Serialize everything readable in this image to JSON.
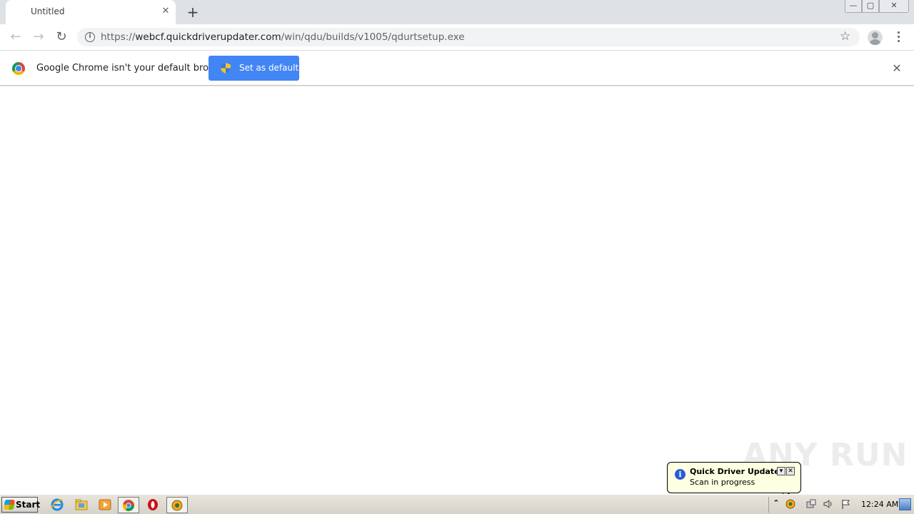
{
  "browser": {
    "tab": {
      "title": "Untitled",
      "close_glyph": "✕"
    },
    "new_tab_glyph": "+",
    "window_controls": {
      "minimize": "—",
      "maximize": "▢",
      "close": "✕"
    },
    "nav": {
      "back": "←",
      "forward": "→",
      "reload": "↻"
    },
    "omnibox": {
      "scheme": "https://",
      "host": "webcf.quickdriverupdater.com",
      "path": "/win/qdu/builds/v1005/qdurtsetup.exe"
    },
    "bookmark_star": "☆"
  },
  "infobar": {
    "message": "Google Chrome isn't your default browser",
    "button_label": "Set as default",
    "close_glyph": "✕"
  },
  "watermark": "ANY RUN",
  "balloon": {
    "title": "Quick Driver Updater",
    "text": "Scan in progress",
    "info_glyph": "i",
    "options_glyph": "▾",
    "close_glyph": "✕"
  },
  "taskbar": {
    "start_label": "Start",
    "tray_expand_glyph": "⌃",
    "clock": "12:24 AM"
  },
  "icons": {
    "tab_close": "close-icon",
    "new_tab": "plus-icon",
    "back": "arrow-left-icon",
    "forward": "arrow-right-icon",
    "reload": "reload-icon",
    "site_info": "info-icon",
    "bookmark": "star-icon",
    "profile": "profile-icon",
    "menu": "kebab-menu-icon",
    "chrome": "chrome-logo-icon",
    "uac_shield": "shield-icon"
  },
  "colors": {
    "accent": "#4285f4",
    "tabstrip": "#dee1e6",
    "balloon_bg": "#ffffe1"
  }
}
